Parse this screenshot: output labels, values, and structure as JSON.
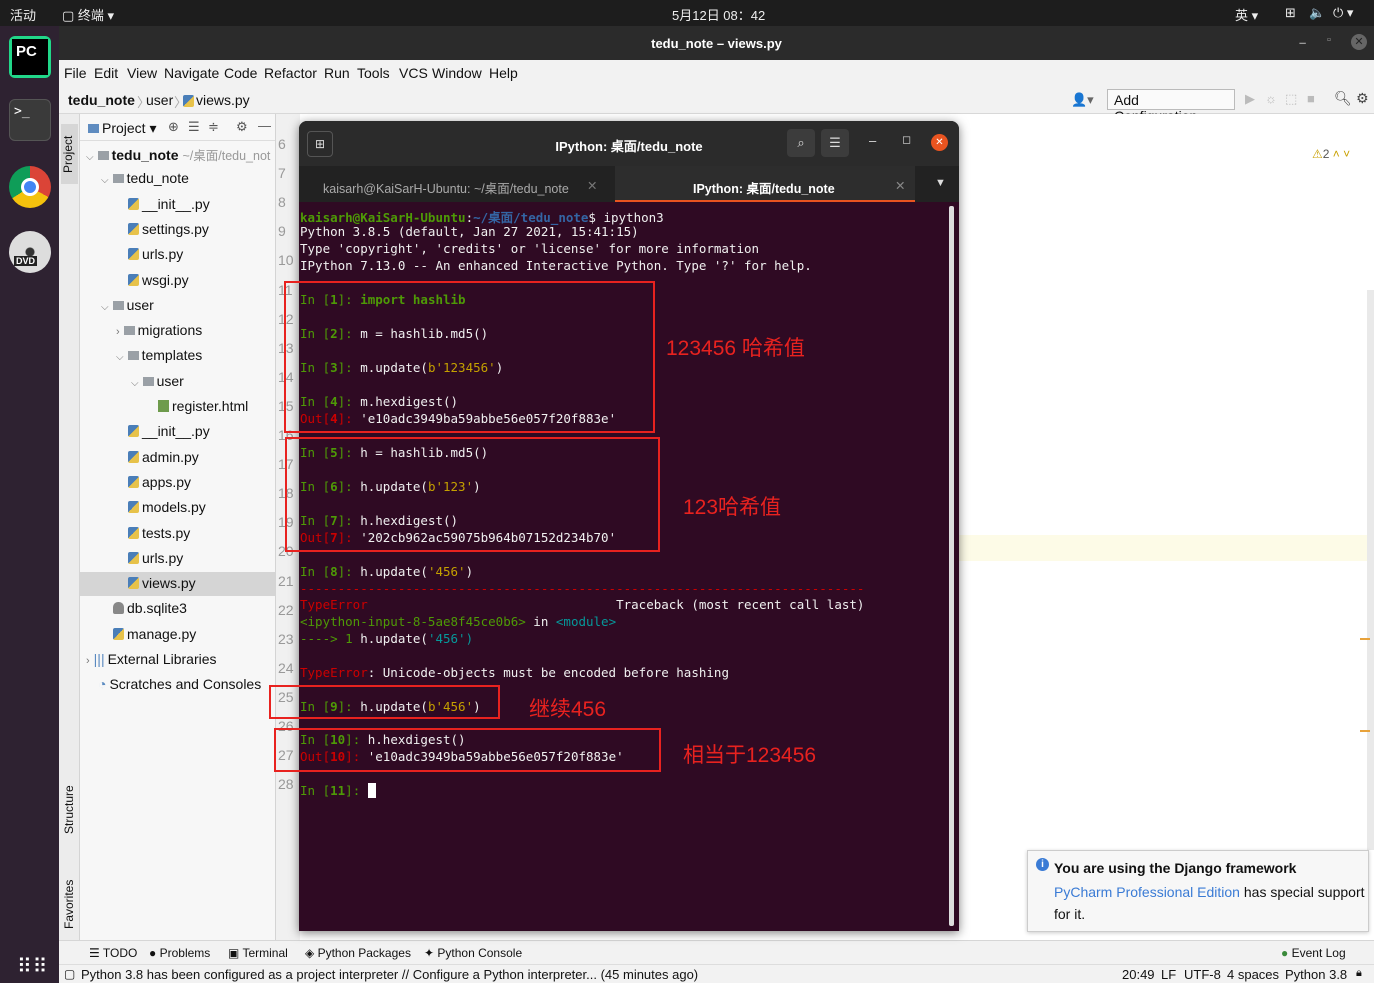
{
  "topbar": {
    "activities": "活动",
    "app_menu": "终端",
    "clock": "5月12日 08：42",
    "lang": "英"
  },
  "ide": {
    "window_title": "tedu_note – views.py",
    "menu": [
      "File",
      "Edit",
      "View",
      "Navigate",
      "Code",
      "Refactor",
      "Run",
      "Tools",
      "VCS",
      "Window",
      "Help"
    ],
    "breadcrumb": [
      "tedu_note",
      "user",
      "views.py"
    ],
    "add_config": "Add Configuration...",
    "project_label": "Project",
    "side_tabs": [
      "Project",
      "Structure",
      "Favorites"
    ],
    "tree": [
      {
        "label": "tedu_note",
        "suffix": "~/桌面/tedu_not",
        "type": "folder",
        "indent": 0,
        "arrow": "v"
      },
      {
        "label": "tedu_note",
        "type": "folder",
        "indent": 1,
        "arrow": "v"
      },
      {
        "label": "__init__.py",
        "type": "py",
        "indent": 2
      },
      {
        "label": "settings.py",
        "type": "py",
        "indent": 2
      },
      {
        "label": "urls.py",
        "type": "py",
        "indent": 2
      },
      {
        "label": "wsgi.py",
        "type": "py",
        "indent": 2
      },
      {
        "label": "user",
        "type": "folder",
        "indent": 1,
        "arrow": "v"
      },
      {
        "label": "migrations",
        "type": "folder",
        "indent": 2,
        "arrow": ">"
      },
      {
        "label": "templates",
        "type": "folder",
        "indent": 2,
        "arrow": "v"
      },
      {
        "label": "user",
        "type": "folder",
        "indent": 3,
        "arrow": "v"
      },
      {
        "label": "register.html",
        "type": "html",
        "indent": 4
      },
      {
        "label": "__init__.py",
        "type": "py",
        "indent": 2
      },
      {
        "label": "admin.py",
        "type": "py",
        "indent": 2
      },
      {
        "label": "apps.py",
        "type": "py",
        "indent": 2
      },
      {
        "label": "models.py",
        "type": "py",
        "indent": 2
      },
      {
        "label": "tests.py",
        "type": "py",
        "indent": 2
      },
      {
        "label": "urls.py",
        "type": "py",
        "indent": 2
      },
      {
        "label": "views.py",
        "type": "py",
        "indent": 2,
        "selected": true
      },
      {
        "label": "db.sqlite3",
        "type": "db",
        "indent": 1
      },
      {
        "label": "manage.py",
        "type": "py",
        "indent": 1
      },
      {
        "label": "External Libraries",
        "type": "lib",
        "indent": 0,
        "arrow": ">"
      },
      {
        "label": "Scratches and Consoles",
        "type": "scratch",
        "indent": 0
      }
    ],
    "gutter_lines": [
      "6",
      "7",
      "8",
      "9",
      "10",
      "11",
      "12",
      "13",
      "14",
      "15",
      "16",
      "17",
      "18",
      "19",
      "20",
      "21",
      "22",
      "23",
      "24",
      "25",
      "26",
      "27",
      "28"
    ],
    "warning_count": "2",
    "bottom_tools": [
      "TODO",
      "Problems",
      "Terminal",
      "Python Packages",
      "Python Console",
      "Event Log"
    ],
    "status_message": "Python 3.8 has been configured as a project interpreter // Configure a Python interpreter... (45 minutes ago)",
    "status_right": [
      "20:49",
      "LF",
      "UTF-8",
      "4 spaces",
      "Python 3.8"
    ],
    "notification": {
      "title": "You are using the Django framework",
      "link": "PyCharm Professional Edition",
      "body1": "has special support",
      "body2": "for it."
    }
  },
  "terminal": {
    "title": "IPython: 桌面/tedu_note",
    "tab1": "kaisarh@KaiSarH-Ubuntu: ~/桌面/tedu_note",
    "tab2": "IPython: 桌面/tedu_note",
    "prompt_user": "kaisarh@KaiSarH-Ubuntu",
    "prompt_path": "~/桌面/tedu_note",
    "prompt_cmd": "$ ipython3",
    "banner": [
      "Python 3.8.5 (default, Jan 27 2021, 15:41:15)",
      "Type 'copyright', 'credits' or 'license' for more information",
      "IPython 7.13.0 -- An enhanced Interactive Python. Type '?' for help."
    ],
    "cells": {
      "in1": "import hashlib",
      "in2": "m = hashlib.md5()",
      "in3_pre": "m.update(",
      "in3_str": "b'123456'",
      "in4": "m.hexdigest()",
      "out4": "'e10adc3949ba59abbe56e057f20f883e'",
      "in5": "h = hashlib.md5()",
      "in6_pre": "h.update(",
      "in6_str": "b'123'",
      "in7": "h.hexdigest()",
      "out7": "'202cb962ac59075b964b07152d234b70'",
      "in8_pre": "h.update(",
      "in8_str": "'456'",
      "dashes": "---------------------------------------------------------------------------",
      "err_name": "TypeError",
      "traceback": "Traceback (most recent call last)",
      "tb_file": "<ipython-input-8-5ae8f45ce0b6>",
      "tb_in": " in ",
      "tb_module": "<module>",
      "tb_arrow": "----> 1 ",
      "tb_code_pre": "h.update(",
      "tb_code_str": "'456'",
      "err_msg": ": Unicode-objects must be encoded before hashing",
      "in9_pre": "h.update(",
      "in9_str": "b'456'",
      "in10": "h.hexdigest()",
      "out10": "'e10adc3949ba59abbe56e057f20f883e'"
    },
    "annotations": [
      "123456 哈希值",
      "123哈希值",
      "继续456",
      "相当于123456"
    ]
  },
  "colors": {
    "annotation_red": "#e8221f",
    "terminal_bg": "#2f0a23",
    "prompt_green": "#4e9a06",
    "out_red": "#cc0000"
  }
}
